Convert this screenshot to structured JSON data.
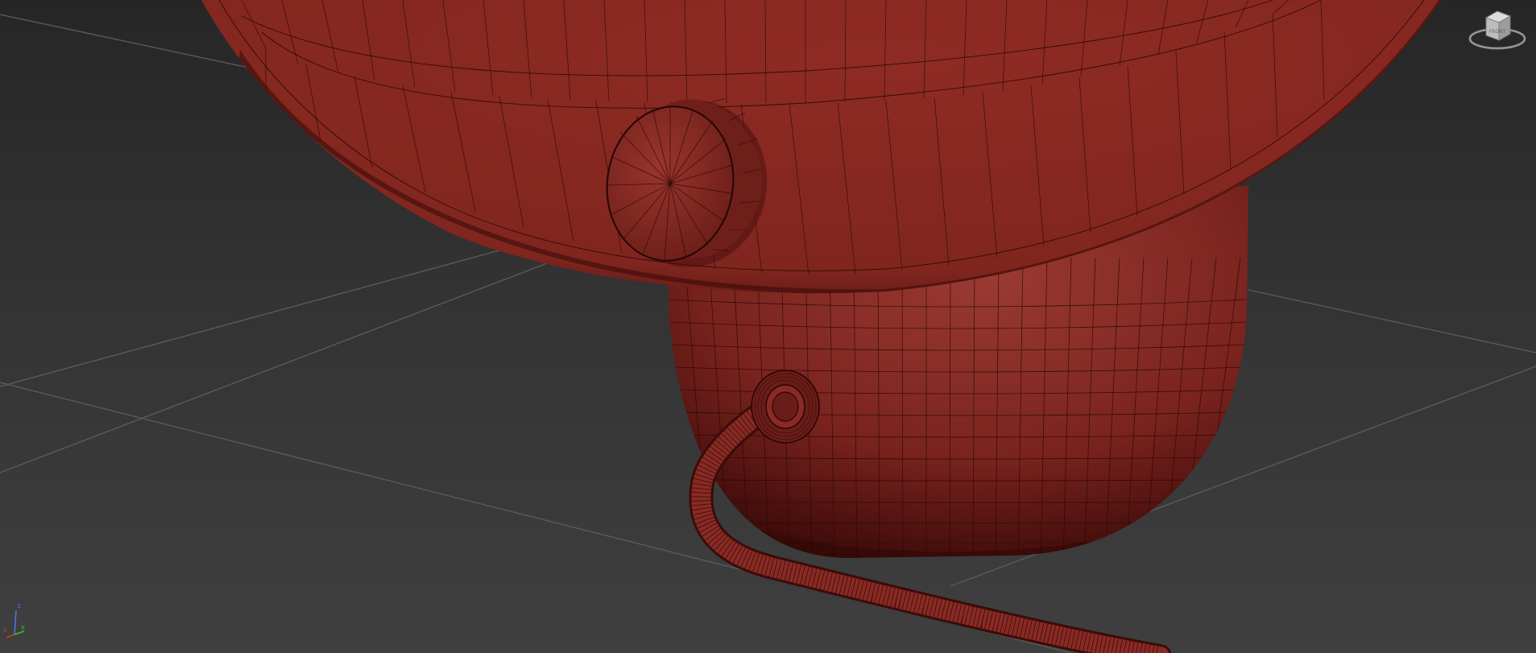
{
  "viewport": {
    "background": "#333333",
    "model_color": "#8a2a24",
    "wire_color": "#2a0806",
    "grid_color": "#5a5a5a"
  },
  "viewcube": {
    "icon": "viewcube-icon",
    "label": "FRONT"
  },
  "axis_tripod": {
    "icon": "axis-tripod-icon",
    "x_label": "x",
    "y_label": "y",
    "z_label": "z",
    "x_color": "#d03a2a",
    "y_color": "#3ac03a",
    "z_color": "#4a7ae0"
  }
}
